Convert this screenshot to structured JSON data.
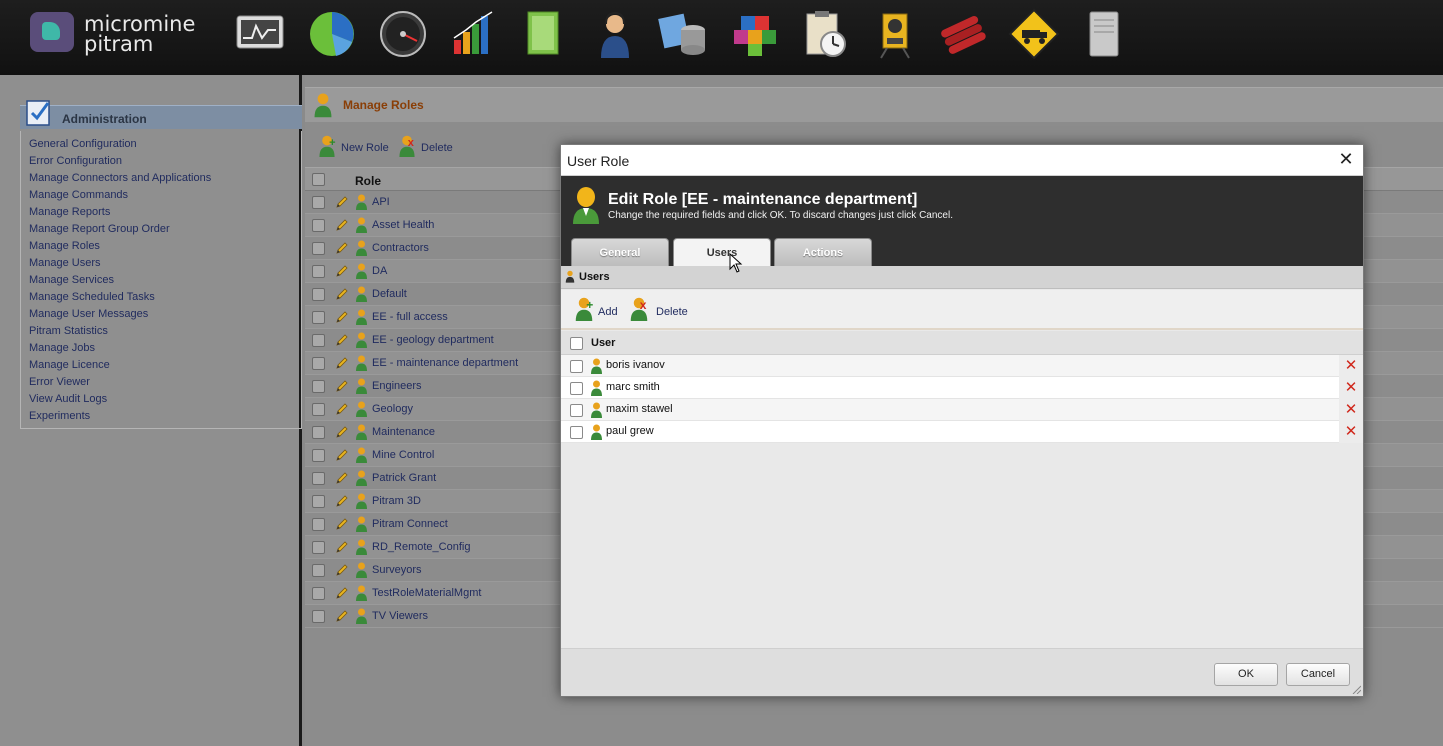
{
  "brand": {
    "line1": "micromine",
    "line2": "pitram"
  },
  "app_icons": [
    "monitor-chart-icon",
    "pie-chart-icon",
    "gauge-icon",
    "bar-chart-icon",
    "document-icon",
    "operator-headset-icon",
    "database-icon",
    "cubes-icon",
    "clipboard-clock-icon",
    "survey-instrument-icon",
    "explosives-icon",
    "haul-truck-sign-icon",
    "server-tower-icon"
  ],
  "admin": {
    "title": "Administration",
    "items": [
      "General Configuration",
      "Error Configuration",
      "Manage Connectors and Applications",
      "Manage Commands",
      "Manage Reports",
      "Manage Report Group Order",
      "Manage Roles",
      "Manage Users",
      "Manage Services",
      "Manage Scheduled Tasks",
      "Manage User Messages",
      "Pitram Statistics",
      "Manage Jobs",
      "Manage Licence",
      "Error Viewer",
      "View Audit Logs",
      "Experiments"
    ]
  },
  "main": {
    "title": "Manage Roles",
    "toolbar": {
      "new_role": "New Role",
      "delete": "Delete"
    },
    "column_role": "Role",
    "roles": [
      "API",
      "Asset Health",
      "Contractors",
      "DA",
      "Default",
      "EE - full access",
      "EE - geology department",
      "EE - maintenance department",
      "Engineers",
      "Geology",
      "Maintenance",
      "Mine Control",
      "Patrick Grant",
      "Pitram 3D",
      "Pitram Connect",
      "RD_Remote_Config",
      "Surveyors",
      "TestRoleMaterialMgmt",
      "TV Viewers"
    ]
  },
  "dialog": {
    "window_title": "User Role",
    "close_glyph": "✕",
    "heading": "Edit Role [EE - maintenance department]",
    "subheading": "Change the required fields and click OK. To discard changes just click Cancel.",
    "tabs": [
      {
        "label": "General"
      },
      {
        "label": "Users"
      },
      {
        "label": "Actions"
      }
    ],
    "active_tab": "Users",
    "section_title": "Users",
    "toolbar": {
      "add": "Add",
      "delete": "Delete"
    },
    "column_user": "User",
    "users": [
      "boris ivanov",
      "marc smith",
      "maxim stawel",
      "paul grew"
    ],
    "remove_glyph": "✕",
    "ok": "OK",
    "cancel": "Cancel"
  },
  "colors": {
    "accent_link": "#1f2a5e",
    "title_orange": "#8a3e06",
    "delete_red": "#d0281c",
    "dialog_header": "#2e2e2e"
  }
}
